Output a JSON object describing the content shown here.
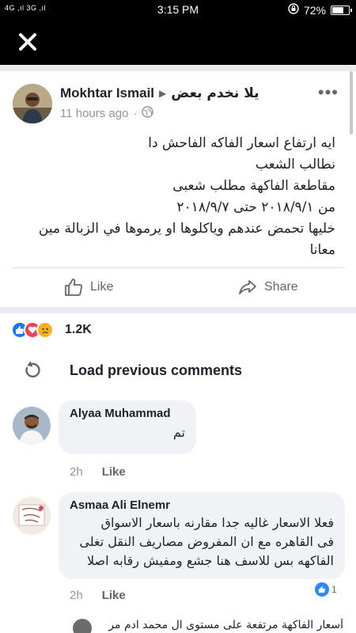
{
  "status_bar": {
    "left_indicators": "4G ,ıl 3G ,ıl",
    "time": "3:15 PM",
    "battery_percent": "72%",
    "battery_level": 0.72
  },
  "post": {
    "author": "Mokhtar Ismail",
    "group": "يلا نخدم بعض",
    "time_ago": "11 hours ago",
    "more": "•••",
    "text_lines": [
      "ايه ارتفاع اسعار الفاكه الفاحش دا",
      "نطالب الشعب",
      "مقاطعة الفاكهة مطلب شعبى",
      "من ٢٠١٨/٩/١  حتى ٢٠١٨/٩/٧",
      "خليها تحمض عندهم وياكلوها او يرموها في الزبالة مين",
      "معانا"
    ],
    "like_label": "Like",
    "share_label": "Share",
    "reactions": [
      "like",
      "love",
      "sad"
    ],
    "reaction_count": "1.2K"
  },
  "comments": {
    "load_previous_label": "Load previous comments",
    "items": [
      {
        "name": "Alyaa Muhammad",
        "text_lines": [
          "تم"
        ],
        "time": "2h",
        "like_label": "Like"
      },
      {
        "name": "Asmaa Ali Elnemr",
        "text_lines": [
          "فعلا الاسعار غاليه جدا مقارنه باسعار الاسواق",
          "فى القاهره مع ان المفروض مصاريف النقل تغلى",
          "الفاكهه بس للاسف هنا جشع ومفيش رقابه اصلا"
        ],
        "time": "2h",
        "like_label": "Like",
        "reaction_count": "1"
      }
    ],
    "partial_text": "أسعار الفاكهة مرتفعة على مستوى ال محمد ادم مر"
  },
  "colors": {
    "facebook_blue": "#1877f2",
    "like_blue": "#2d88ff",
    "love_red": "#f33e58",
    "sad_yellow": "#f7b125",
    "bubble_gray": "#f0f2f5",
    "meta_gray": "#90949c"
  }
}
